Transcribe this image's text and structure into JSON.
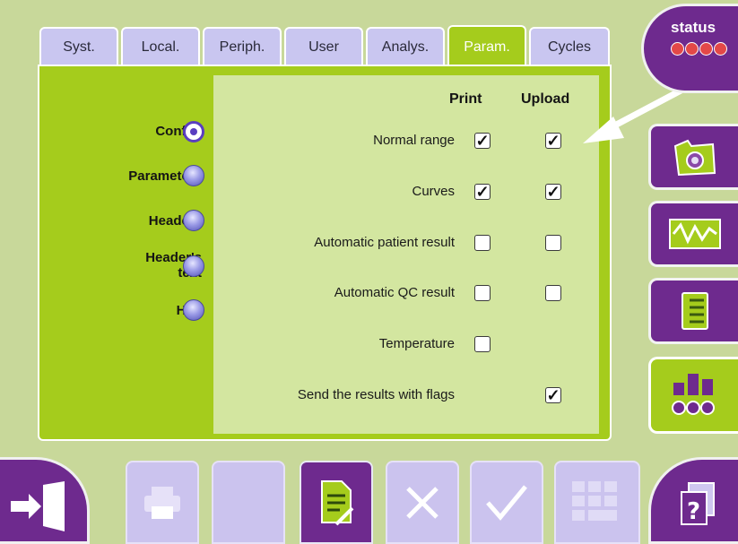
{
  "tabs": [
    {
      "label": "Syst.",
      "active": false
    },
    {
      "label": "Local.",
      "active": false
    },
    {
      "label": "Periph.",
      "active": false
    },
    {
      "label": "User",
      "active": false
    },
    {
      "label": "Analys.",
      "active": false
    },
    {
      "label": "Param.",
      "active": true
    },
    {
      "label": "Cycles",
      "active": false
    }
  ],
  "sidebar": {
    "items": [
      {
        "label": "Config.",
        "selected": true
      },
      {
        "label": "Parameters",
        "selected": false
      },
      {
        "label": "Headers",
        "selected": false
      },
      {
        "label": "Header's text",
        "selected": false
      },
      {
        "label": "HL7",
        "selected": false
      }
    ]
  },
  "columns": {
    "print": "Print",
    "upload": "Upload"
  },
  "rows": [
    {
      "label": "Normal range",
      "print": true,
      "upload": true
    },
    {
      "label": "Curves",
      "print": true,
      "upload": true
    },
    {
      "label": "Automatic patient result",
      "print": false,
      "upload": false
    },
    {
      "label": "Automatic QC result",
      "print": false,
      "upload": false
    },
    {
      "label": "Temperature",
      "print": false,
      "upload": null
    },
    {
      "label": "Send the results with flags",
      "print": null,
      "upload": true
    }
  ],
  "status": {
    "label": "status"
  },
  "icons": {
    "right_buttons": [
      "folder-camera-icon",
      "waveform-icon",
      "binder-icon",
      "settings-levels-icon"
    ],
    "bottom_buttons": [
      "exit-door-icon",
      "printer-icon",
      "blank-button",
      "document-edit-icon",
      "cancel-x-icon",
      "validate-check-icon",
      "keypad-icon",
      "help-icon"
    ]
  },
  "colors": {
    "accent_green": "#a5cc1c",
    "purple": "#6e2a8e",
    "tab_lavender": "#c9c6f0",
    "background": "#c8d89a"
  }
}
